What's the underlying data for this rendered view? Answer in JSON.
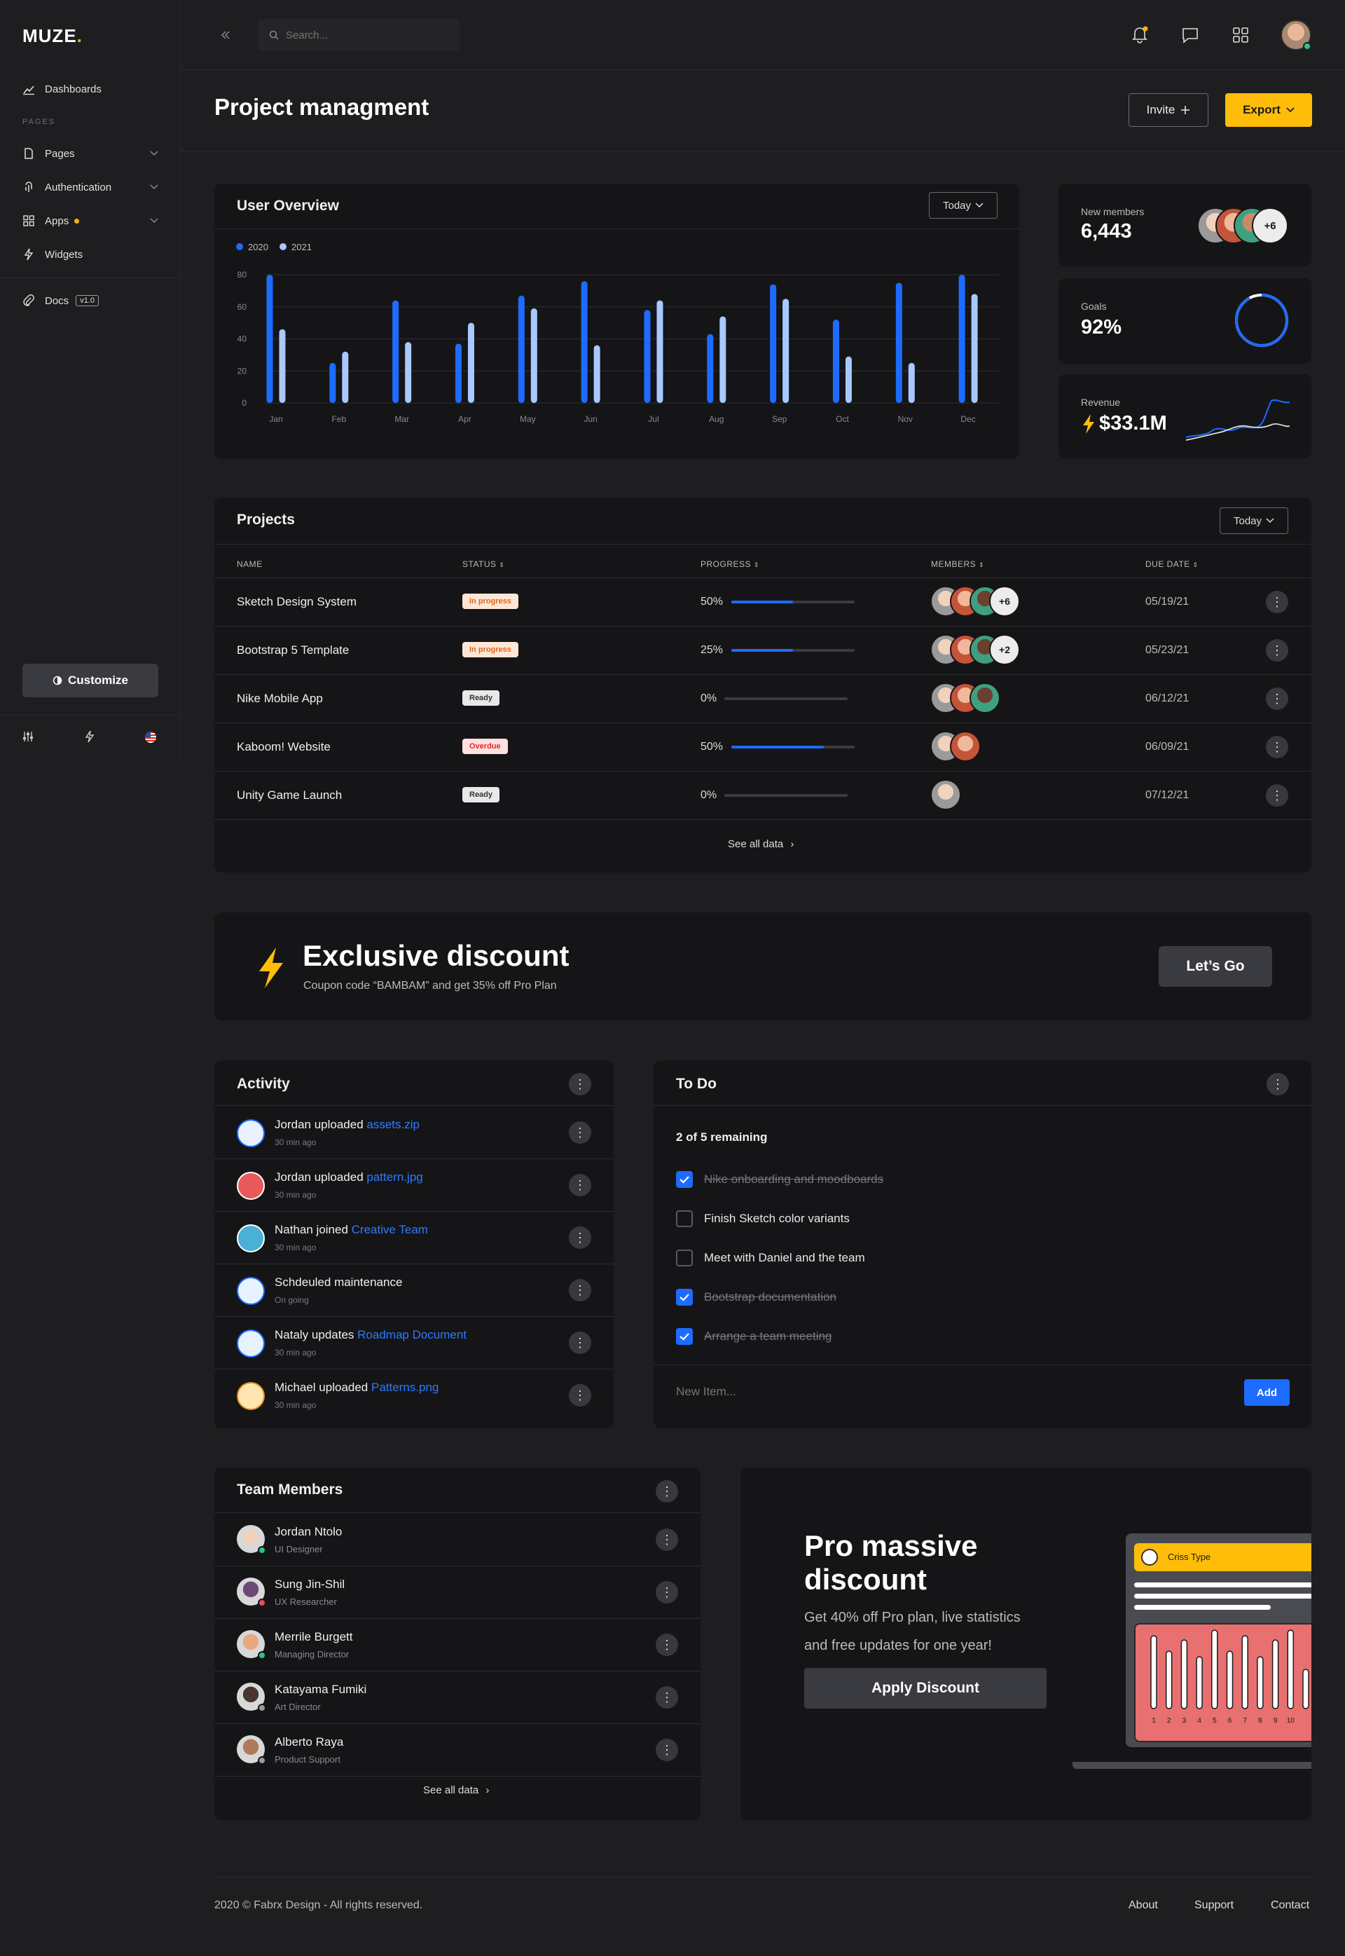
{
  "brand": {
    "name": "MUZE"
  },
  "sidebar": {
    "dashboards": "Dashboards",
    "pages_heading": "PAGES",
    "items": [
      {
        "label": "Pages",
        "icon": "page-icon"
      },
      {
        "label": "Authentication",
        "icon": "fingerprint-icon"
      },
      {
        "label": "Apps",
        "icon": "grid-icon"
      },
      {
        "label": "Widgets",
        "icon": "bolt-icon"
      }
    ],
    "docs": "Docs",
    "docs_version": "v1.0",
    "customize": "Customize"
  },
  "topbar": {
    "search_placeholder": "Search..."
  },
  "page": {
    "title": "Project managment",
    "invite_label": "Invite",
    "export_label": "Export"
  },
  "overview": {
    "title": "User Overview",
    "filter": "Today",
    "legend": [
      "2020",
      "2021"
    ]
  },
  "chart_data": {
    "type": "bar",
    "categories": [
      "Jan",
      "Feb",
      "Mar",
      "Apr",
      "May",
      "Jun",
      "Jul",
      "Aug",
      "Sep",
      "Oct",
      "Nov",
      "Dec"
    ],
    "series": [
      {
        "name": "2020",
        "values": [
          80,
          25,
          64,
          37,
          67,
          76,
          58,
          43,
          74,
          52,
          75,
          80
        ],
        "color": "#1e6bff"
      },
      {
        "name": "2021",
        "values": [
          46,
          32,
          38,
          50,
          59,
          36,
          64,
          54,
          65,
          29,
          25,
          68
        ],
        "color": "#a8c8ff"
      }
    ],
    "ylim": [
      0,
      80
    ],
    "yticks": [
      0,
      20,
      40,
      60,
      80
    ],
    "grid": true,
    "legend": "top-left"
  },
  "stats": {
    "members_label": "New members",
    "members_value": "6,443",
    "members_more": "+6",
    "goals_label": "Goals",
    "goals_value": "92%",
    "goals_progress": 0.92,
    "revenue_label": "Revenue",
    "revenue_value": "$33.1M"
  },
  "projects": {
    "title": "Projects",
    "filter": "Today",
    "columns": [
      "NAME",
      "STATUS",
      "PROGRESS",
      "MEMBERS",
      "DUE DATE"
    ],
    "rows": [
      {
        "name": "Sketch Design System",
        "status": "In progress",
        "progress": "50%",
        "pct": 0.5,
        "members": 3,
        "more": "+6",
        "due": "05/19/21"
      },
      {
        "name": "Bootstrap 5 Template",
        "status": "In progress",
        "progress": "25%",
        "pct": 0.5,
        "members": 3,
        "more": "+2",
        "due": "05/23/21"
      },
      {
        "name": "Nike Mobile App",
        "status": "Ready",
        "progress": "0%",
        "pct": 0,
        "members": 3,
        "more": "",
        "due": "06/12/21"
      },
      {
        "name": "Kaboom! Website",
        "status": "Overdue",
        "progress": "50%",
        "pct": 0.75,
        "members": 2,
        "more": "",
        "due": "06/09/21"
      },
      {
        "name": "Unity Game Launch",
        "status": "Ready",
        "progress": "0%",
        "pct": 0,
        "members": 1,
        "more": "",
        "due": "07/12/21"
      }
    ],
    "see_all": "See all data"
  },
  "promo": {
    "title": "Exclusive discount",
    "subtitle": "Coupon code “BAMBAM” and get 35% off Pro Plan",
    "button": "Let’s Go"
  },
  "activity": {
    "title": "Activity",
    "items": [
      {
        "text": "Jordan uploaded ",
        "link": "assets.zip",
        "time": "30 min ago"
      },
      {
        "text": "Jordan uploaded ",
        "link": "pattern.jpg",
        "time": "30 min ago"
      },
      {
        "text": "Nathan joined ",
        "link": "Creative Team",
        "time": "30 min ago"
      },
      {
        "text": "Schdeuled maintenance",
        "link": "",
        "time": "On going"
      },
      {
        "text": "Nataly updates ",
        "link": "Roadmap Document",
        "time": "30 min ago"
      },
      {
        "text": "Michael uploaded ",
        "link": "Patterns.png",
        "time": "30 min ago"
      }
    ]
  },
  "todo": {
    "title": "To Do",
    "remaining": "2 of 5 remaining",
    "items": [
      {
        "text": "Nike onboarding and moodboards",
        "done": true
      },
      {
        "text": "Finish Sketch color variants",
        "done": false
      },
      {
        "text": "Meet with Daniel and the team",
        "done": false
      },
      {
        "text": "Bootstrap documentation",
        "done": true
      },
      {
        "text": "Arrange a team meeting",
        "done": true
      }
    ],
    "new_placeholder": "New Item...",
    "add_label": "Add"
  },
  "team": {
    "title": "Team Members",
    "members": [
      {
        "name": "Jordan Ntolo",
        "role": "UI Designer"
      },
      {
        "name": "Sung Jin-Shil",
        "role": "UX Researcher"
      },
      {
        "name": "Merrile Burgett",
        "role": "Managing Director"
      },
      {
        "name": "Katayama Fumiki",
        "role": "Art Director"
      },
      {
        "name": "Alberto Raya",
        "role": "Product Support"
      }
    ],
    "see_all": "See all data"
  },
  "pro": {
    "title_line1": "Pro massive",
    "title_line2": "discount",
    "text_line1": "Get 40% off Pro plan, live statistics",
    "text_line2": "and free updates for one year!",
    "button": "Apply Discount",
    "illustration_label": "Criss Type",
    "illustration_ticks": [
      "1",
      "2",
      "3",
      "4",
      "5",
      "6",
      "7",
      "8",
      "9",
      "10"
    ]
  },
  "footer": {
    "copyright": "2020 © Fabrx Design - All rights reserved.",
    "links": [
      "About",
      "Support",
      "Contact"
    ]
  }
}
